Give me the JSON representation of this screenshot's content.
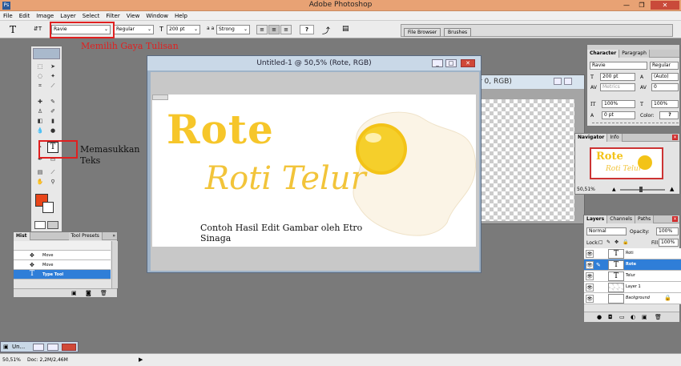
{
  "app": {
    "title": "Adobe Photoshop",
    "minimize": "—",
    "maximize": "❐",
    "close": "✕"
  },
  "menu": [
    "File",
    "Edit",
    "Image",
    "Layer",
    "Select",
    "Filter",
    "View",
    "Window",
    "Help"
  ],
  "options": {
    "tool_glyph": "T",
    "orient_glyph": "⇵T",
    "font_family": "Ravie",
    "font_style": "Regular",
    "font_size": "200 pt",
    "aa_label": "a a",
    "aa_method": "Strong",
    "warp": "?",
    "file_browser": "File Browser",
    "brushes": "Brushes"
  },
  "annotations": {
    "font_choice": "Memilih Gaya Tulisan",
    "insert_text_1": "Memasukkan",
    "insert_text_2": "Teks"
  },
  "doc_window": {
    "title": "Untitled-1 @ 50,5% (Rote, RGB)",
    "min": "_",
    "max": "□",
    "close": "✕"
  },
  "back_window": {
    "title_fragment": "r 0, RGB)"
  },
  "canvas": {
    "rote": "Rote",
    "roti_telur": "Roti Telur",
    "caption_1": "Contoh Hasil Edit Gambar oleh Etro",
    "caption_2": "Sinaga"
  },
  "character": {
    "tab1": "Character",
    "tab2": "Paragraph",
    "font": "Ravie",
    "style": "Regular",
    "size": "200 pt",
    "leading": "(Auto)",
    "kerning": "Metrics",
    "tracking": "0",
    "vscale": "100%",
    "hscale": "100%",
    "baseline": "0 pt",
    "color_label": "Color:",
    "color_btn": "?"
  },
  "navigator": {
    "tab1": "Navigator",
    "tab2": "Info",
    "zoom": "50,51%",
    "thumb_rote": "Rote",
    "thumb_roti": "Roti Telur"
  },
  "layers": {
    "tab1": "Layers",
    "tab2": "Channels",
    "tab3": "Paths",
    "blend": "Normal",
    "opacity_label": "Opacity:",
    "opacity": "100%",
    "lock_label": "Lock:",
    "fill_label": "Fill:",
    "fill": "100%",
    "items": [
      {
        "name": "Roti",
        "thumb": "T"
      },
      {
        "name": "Rote",
        "thumb": "T"
      },
      {
        "name": "Telur",
        "thumb": "T"
      },
      {
        "name": "Layer 1",
        "thumb": ""
      },
      {
        "name": "Background",
        "thumb": ""
      }
    ]
  },
  "history": {
    "tab1": "Hist",
    "tab2": "Tool Presets",
    "items": [
      "Move",
      "Move",
      "Type Tool"
    ]
  },
  "status": {
    "zoom": "50,51%",
    "doc": "Doc: 2,2M/2,46M",
    "arrow": "▶"
  },
  "minimized_doc": {
    "title": "Un..."
  },
  "colors": {
    "accent_red": "#e02020",
    "selection": "#2f7ed8",
    "egg_yolk": "#f3c317",
    "title_bar": "#e8a274"
  }
}
